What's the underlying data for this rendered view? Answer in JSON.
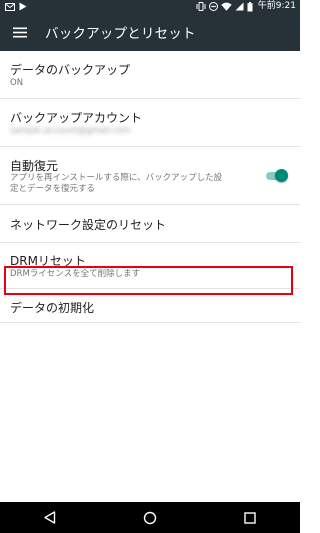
{
  "status_bar": {
    "time": "午前9:21",
    "left_icons": [
      "mail-icon",
      "play-store-icon"
    ],
    "right_icons": [
      "vibrate-icon",
      "minus-circle-icon",
      "wifi-icon",
      "signal-icon",
      "battery-icon"
    ]
  },
  "app_bar": {
    "title": "バックアップとリセット",
    "menu_icon": "menu-icon"
  },
  "settings": {
    "backup": {
      "title": "データのバックアップ",
      "subtitle": "ON"
    },
    "account": {
      "title": "バックアップアカウント",
      "subtitle": "sample.account@gmail.com"
    },
    "auto_restore": {
      "title": "自動復元",
      "subtitle_line1": "アプリを再インストールする際に、バックアップした設",
      "subtitle_line2": "定とデータを復元する",
      "toggle_on": true
    },
    "network_reset": {
      "title": "ネットワーク設定のリセット"
    },
    "drm_reset": {
      "title": "DRMリセット",
      "subtitle": "DRMライセンスを全て削除します"
    },
    "factory_reset": {
      "title": "データの初期化"
    }
  },
  "colors": {
    "app_bar": "#263238",
    "accent": "#00897b",
    "highlight": "#e60012"
  },
  "nav_bar": {
    "buttons": [
      "back-icon",
      "home-icon",
      "recents-icon"
    ]
  }
}
